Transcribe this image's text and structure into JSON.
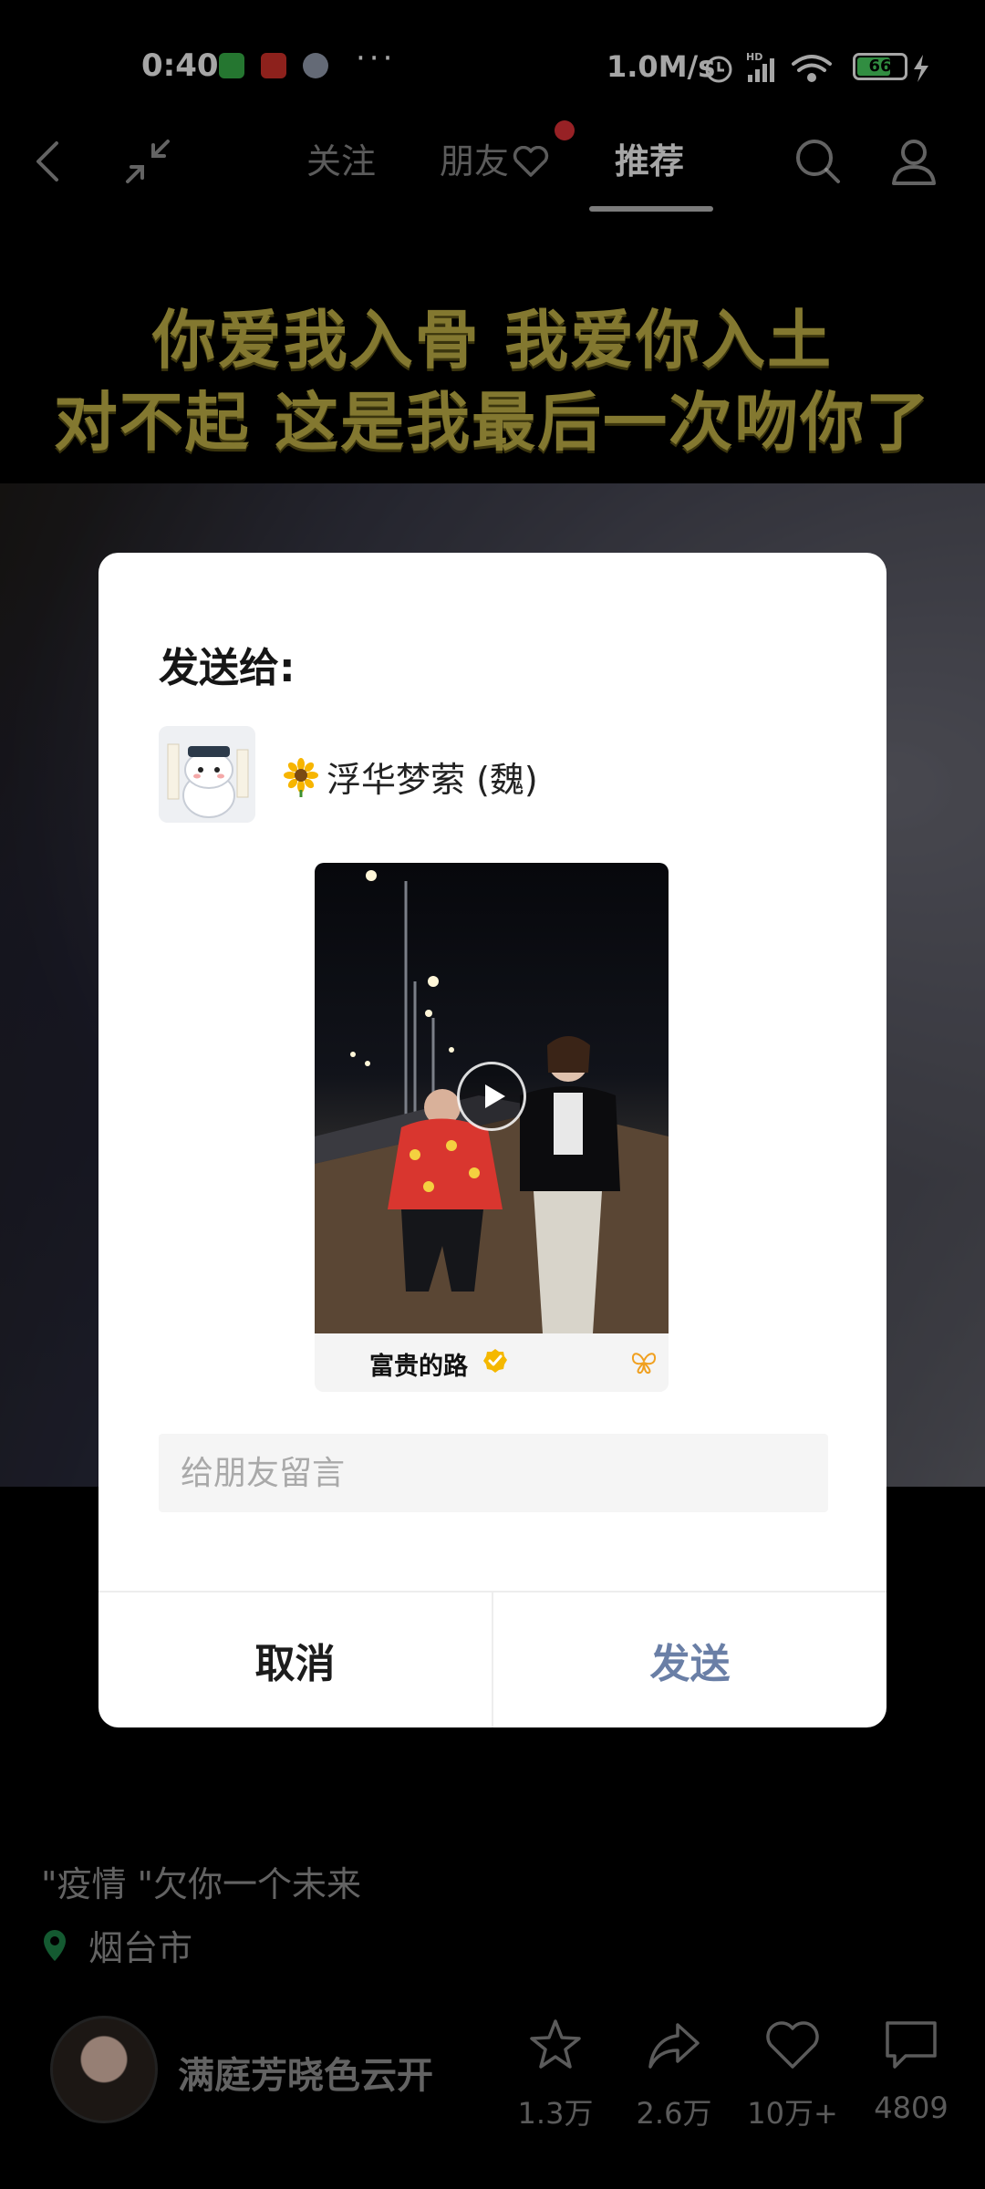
{
  "status_bar": {
    "time": "0:40",
    "more": "···",
    "network_speed": "1.0M/s",
    "battery_level": "66"
  },
  "nav": {
    "tabs": [
      {
        "label": "关注"
      },
      {
        "label": "朋友"
      },
      {
        "label": "推荐"
      }
    ],
    "active_tab": "推荐"
  },
  "video": {
    "caption_line1": "你爱我入骨 我爱你入土",
    "caption_line2": "对不起 这是我最后一次吻你了",
    "description": "\"疫情 \"欠你一个未来",
    "location": "烟台市",
    "author": "满庭芳晓色云开",
    "actions": {
      "favorite_count": "1.3万",
      "share_count": "2.6万",
      "like_count": "10万+",
      "comment_count": "4809"
    }
  },
  "dialog": {
    "title": "发送给:",
    "recipient_name": "浮华梦萦 (魏)",
    "shared_video_author": "富贵的路",
    "message_placeholder": "给朋友留言",
    "cancel_label": "取消",
    "send_label": "发送"
  },
  "colors": {
    "send_button": "#6a7fa6",
    "caption": "#c9b84a",
    "notification_dot": "#e8333a"
  }
}
